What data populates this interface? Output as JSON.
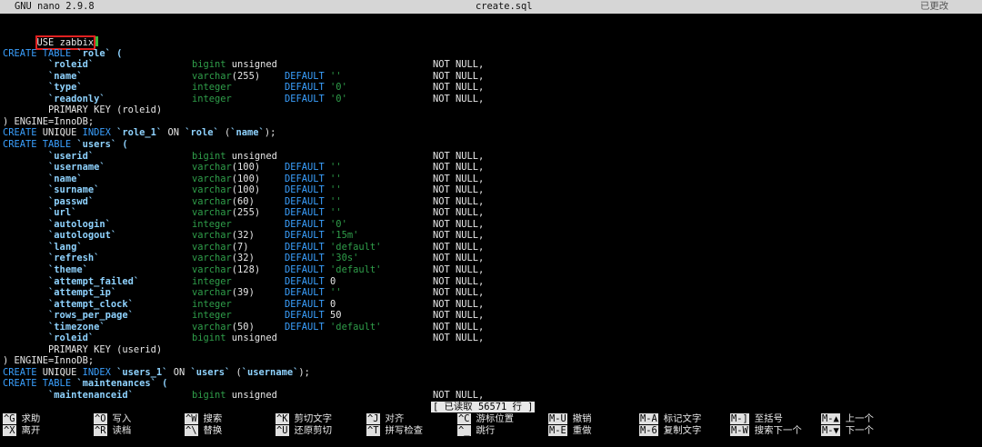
{
  "window": {
    "app_title": "GNU nano 2.9.8",
    "file_name": "create.sql",
    "modified_status": "已更改"
  },
  "editor": {
    "first_line": "USE zabbix",
    "lines": [
      [],
      [
        {
          "t": "CREATE TABLE",
          "c": "kw"
        },
        {
          "t": " `role` (",
          "c": "id"
        }
      ],
      [
        {
          "t": "        `roleid`",
          "c": "id"
        },
        {
          "t": "bigint",
          "c": "ty",
          "col": 208
        },
        {
          "t": " unsigned",
          "c": "pl"
        },
        {
          "t": "NOT NULL,",
          "c": "pl",
          "col": 473
        }
      ],
      [
        {
          "t": "        `name`",
          "c": "id"
        },
        {
          "t": "varchar",
          "c": "ty",
          "col": 208
        },
        {
          "t": "(255)",
          "c": "pl"
        },
        {
          "t": "DEFAULT",
          "c": "kw",
          "col": 310
        },
        {
          "t": " ''",
          "c": "st"
        },
        {
          "t": "NOT NULL,",
          "c": "pl",
          "col": 473
        }
      ],
      [
        {
          "t": "        `type`",
          "c": "id"
        },
        {
          "t": "integer",
          "c": "ty",
          "col": 208
        },
        {
          "t": "DEFAULT",
          "c": "kw",
          "col": 310
        },
        {
          "t": " '0'",
          "c": "st"
        },
        {
          "t": "NOT NULL,",
          "c": "pl",
          "col": 473
        }
      ],
      [
        {
          "t": "        `readonly`",
          "c": "id"
        },
        {
          "t": "integer",
          "c": "ty",
          "col": 208
        },
        {
          "t": "DEFAULT",
          "c": "kw",
          "col": 310
        },
        {
          "t": " '0'",
          "c": "st"
        },
        {
          "t": "NOT NULL,",
          "c": "pl",
          "col": 473
        }
      ],
      [
        {
          "t": "        PRIMARY KEY (roleid)",
          "c": "pl"
        }
      ],
      [
        {
          "t": ") ENGINE=InnoDB;",
          "c": "pl"
        }
      ],
      [
        {
          "t": "CREATE",
          "c": "kw"
        },
        {
          "t": " UNIQUE ",
          "c": "pl"
        },
        {
          "t": "INDEX",
          "c": "kw"
        },
        {
          "t": " `role_1`",
          "c": "id"
        },
        {
          "t": " ON ",
          "c": "pl"
        },
        {
          "t": "`role`",
          "c": "id"
        },
        {
          "t": " (",
          "c": "pl"
        },
        {
          "t": "`name`",
          "c": "id"
        },
        {
          "t": ");",
          "c": "pl"
        }
      ],
      [
        {
          "t": "CREATE TABLE",
          "c": "kw"
        },
        {
          "t": " `users` (",
          "c": "id"
        }
      ],
      [
        {
          "t": "        `userid`",
          "c": "id"
        },
        {
          "t": "bigint",
          "c": "ty",
          "col": 208
        },
        {
          "t": " unsigned",
          "c": "pl"
        },
        {
          "t": "NOT NULL,",
          "c": "pl",
          "col": 473
        }
      ],
      [
        {
          "t": "        `username`",
          "c": "id"
        },
        {
          "t": "varchar",
          "c": "ty",
          "col": 208
        },
        {
          "t": "(100)",
          "c": "pl"
        },
        {
          "t": "DEFAULT",
          "c": "kw",
          "col": 310
        },
        {
          "t": " ''",
          "c": "st"
        },
        {
          "t": "NOT NULL,",
          "c": "pl",
          "col": 473
        }
      ],
      [
        {
          "t": "        `name`",
          "c": "id"
        },
        {
          "t": "varchar",
          "c": "ty",
          "col": 208
        },
        {
          "t": "(100)",
          "c": "pl"
        },
        {
          "t": "DEFAULT",
          "c": "kw",
          "col": 310
        },
        {
          "t": " ''",
          "c": "st"
        },
        {
          "t": "NOT NULL,",
          "c": "pl",
          "col": 473
        }
      ],
      [
        {
          "t": "        `surname`",
          "c": "id"
        },
        {
          "t": "varchar",
          "c": "ty",
          "col": 208
        },
        {
          "t": "(100)",
          "c": "pl"
        },
        {
          "t": "DEFAULT",
          "c": "kw",
          "col": 310
        },
        {
          "t": " ''",
          "c": "st"
        },
        {
          "t": "NOT NULL,",
          "c": "pl",
          "col": 473
        }
      ],
      [
        {
          "t": "        `passwd`",
          "c": "id"
        },
        {
          "t": "varchar",
          "c": "ty",
          "col": 208
        },
        {
          "t": "(60)",
          "c": "pl"
        },
        {
          "t": "DEFAULT",
          "c": "kw",
          "col": 310
        },
        {
          "t": " ''",
          "c": "st"
        },
        {
          "t": "NOT NULL,",
          "c": "pl",
          "col": 473
        }
      ],
      [
        {
          "t": "        `url`",
          "c": "id"
        },
        {
          "t": "varchar",
          "c": "ty",
          "col": 208
        },
        {
          "t": "(255)",
          "c": "pl"
        },
        {
          "t": "DEFAULT",
          "c": "kw",
          "col": 310
        },
        {
          "t": " ''",
          "c": "st"
        },
        {
          "t": "NOT NULL,",
          "c": "pl",
          "col": 473
        }
      ],
      [
        {
          "t": "        `autologin`",
          "c": "id"
        },
        {
          "t": "integer",
          "c": "ty",
          "col": 208
        },
        {
          "t": "DEFAULT",
          "c": "kw",
          "col": 310
        },
        {
          "t": " '0'",
          "c": "st"
        },
        {
          "t": "NOT NULL,",
          "c": "pl",
          "col": 473
        }
      ],
      [
        {
          "t": "        `autologout`",
          "c": "id"
        },
        {
          "t": "varchar",
          "c": "ty",
          "col": 208
        },
        {
          "t": "(32)",
          "c": "pl"
        },
        {
          "t": "DEFAULT",
          "c": "kw",
          "col": 310
        },
        {
          "t": " '15m'",
          "c": "st"
        },
        {
          "t": "NOT NULL,",
          "c": "pl",
          "col": 473
        }
      ],
      [
        {
          "t": "        `lang`",
          "c": "id"
        },
        {
          "t": "varchar",
          "c": "ty",
          "col": 208
        },
        {
          "t": "(7)",
          "c": "pl"
        },
        {
          "t": "DEFAULT",
          "c": "kw",
          "col": 310
        },
        {
          "t": " 'default'",
          "c": "st"
        },
        {
          "t": "NOT NULL,",
          "c": "pl",
          "col": 473
        }
      ],
      [
        {
          "t": "        `refresh`",
          "c": "id"
        },
        {
          "t": "varchar",
          "c": "ty",
          "col": 208
        },
        {
          "t": "(32)",
          "c": "pl"
        },
        {
          "t": "DEFAULT",
          "c": "kw",
          "col": 310
        },
        {
          "t": " '30s'",
          "c": "st"
        },
        {
          "t": "NOT NULL,",
          "c": "pl",
          "col": 473
        }
      ],
      [
        {
          "t": "        `theme`",
          "c": "id"
        },
        {
          "t": "varchar",
          "c": "ty",
          "col": 208
        },
        {
          "t": "(128)",
          "c": "pl"
        },
        {
          "t": "DEFAULT",
          "c": "kw",
          "col": 310
        },
        {
          "t": " 'default'",
          "c": "st"
        },
        {
          "t": "NOT NULL,",
          "c": "pl",
          "col": 473
        }
      ],
      [
        {
          "t": "        `attempt_failed`",
          "c": "id"
        },
        {
          "t": "integer",
          "c": "ty",
          "col": 208
        },
        {
          "t": "DEFAULT",
          "c": "kw",
          "col": 310
        },
        {
          "t": " 0",
          "c": "pl"
        },
        {
          "t": "NOT NULL,",
          "c": "pl",
          "col": 473
        }
      ],
      [
        {
          "t": "        `attempt_ip`",
          "c": "id"
        },
        {
          "t": "varchar",
          "c": "ty",
          "col": 208
        },
        {
          "t": "(39)",
          "c": "pl"
        },
        {
          "t": "DEFAULT",
          "c": "kw",
          "col": 310
        },
        {
          "t": " ''",
          "c": "st"
        },
        {
          "t": "NOT NULL,",
          "c": "pl",
          "col": 473
        }
      ],
      [
        {
          "t": "        `attempt_clock`",
          "c": "id"
        },
        {
          "t": "integer",
          "c": "ty",
          "col": 208
        },
        {
          "t": "DEFAULT",
          "c": "kw",
          "col": 310
        },
        {
          "t": " 0",
          "c": "pl"
        },
        {
          "t": "NOT NULL,",
          "c": "pl",
          "col": 473
        }
      ],
      [
        {
          "t": "        `rows_per_page`",
          "c": "id"
        },
        {
          "t": "integer",
          "c": "ty",
          "col": 208
        },
        {
          "t": "DEFAULT",
          "c": "kw",
          "col": 310
        },
        {
          "t": " 50",
          "c": "pl"
        },
        {
          "t": "NOT NULL,",
          "c": "pl",
          "col": 473
        }
      ],
      [
        {
          "t": "        `timezone`",
          "c": "id"
        },
        {
          "t": "varchar",
          "c": "ty",
          "col": 208
        },
        {
          "t": "(50)",
          "c": "pl"
        },
        {
          "t": "DEFAULT",
          "c": "kw",
          "col": 310
        },
        {
          "t": " 'default'",
          "c": "st"
        },
        {
          "t": "NOT NULL,",
          "c": "pl",
          "col": 473
        }
      ],
      [
        {
          "t": "        `roleid`",
          "c": "id"
        },
        {
          "t": "bigint",
          "c": "ty",
          "col": 208
        },
        {
          "t": " unsigned",
          "c": "pl"
        },
        {
          "t": "NOT NULL,",
          "c": "pl",
          "col": 473
        }
      ],
      [
        {
          "t": "        PRIMARY KEY (userid)",
          "c": "pl"
        }
      ],
      [
        {
          "t": ") ENGINE=InnoDB;",
          "c": "pl"
        }
      ],
      [
        {
          "t": "CREATE",
          "c": "kw"
        },
        {
          "t": " UNIQUE ",
          "c": "pl"
        },
        {
          "t": "INDEX",
          "c": "kw"
        },
        {
          "t": " `users_1`",
          "c": "id"
        },
        {
          "t": " ON ",
          "c": "pl"
        },
        {
          "t": "`users`",
          "c": "id"
        },
        {
          "t": " (",
          "c": "pl"
        },
        {
          "t": "`username`",
          "c": "id"
        },
        {
          "t": ");",
          "c": "pl"
        }
      ],
      [
        {
          "t": "CREATE TABLE",
          "c": "kw"
        },
        {
          "t": " `maintenances` (",
          "c": "id"
        }
      ],
      [
        {
          "t": "        `maintenanceid`",
          "c": "id"
        },
        {
          "t": "bigint",
          "c": "ty",
          "col": 208
        },
        {
          "t": " unsigned",
          "c": "pl"
        },
        {
          "t": "NOT NULL,",
          "c": "pl",
          "col": 473
        }
      ]
    ]
  },
  "status_message": "[ 已读取 56571 行 ]",
  "shortcuts": [
    {
      "key": "^G",
      "label": "求助"
    },
    {
      "key": "^O",
      "label": "写入"
    },
    {
      "key": "^W",
      "label": "搜索"
    },
    {
      "key": "^K",
      "label": "剪切文字"
    },
    {
      "key": "^J",
      "label": "对齐"
    },
    {
      "key": "^C",
      "label": "游标位置"
    },
    {
      "key": "M-U",
      "label": "撤销"
    },
    {
      "key": "M-A",
      "label": "标记文字"
    },
    {
      "key": "M-]",
      "label": "至括号"
    },
    {
      "key": "M-▲",
      "label": "上一个"
    },
    {
      "key": "^X",
      "label": "离开"
    },
    {
      "key": "^R",
      "label": "读档"
    },
    {
      "key": "^\\",
      "label": "替换"
    },
    {
      "key": "^U",
      "label": "还原剪切"
    },
    {
      "key": "^T",
      "label": "拼写检查"
    },
    {
      "key": "^_",
      "label": "跳行"
    },
    {
      "key": "M-E",
      "label": "重做"
    },
    {
      "key": "M-6",
      "label": "复制文字"
    },
    {
      "key": "M-W",
      "label": "搜索下一个"
    },
    {
      "key": "M-▼",
      "label": "下一个"
    }
  ],
  "colors": {
    "keyword": "#3aa0ff",
    "identifier": "#8fd3ff",
    "type": "#2f9e4a",
    "string": "#2f9e4a",
    "highlight_box": "#e02020",
    "cursor": "#3aba3a"
  }
}
